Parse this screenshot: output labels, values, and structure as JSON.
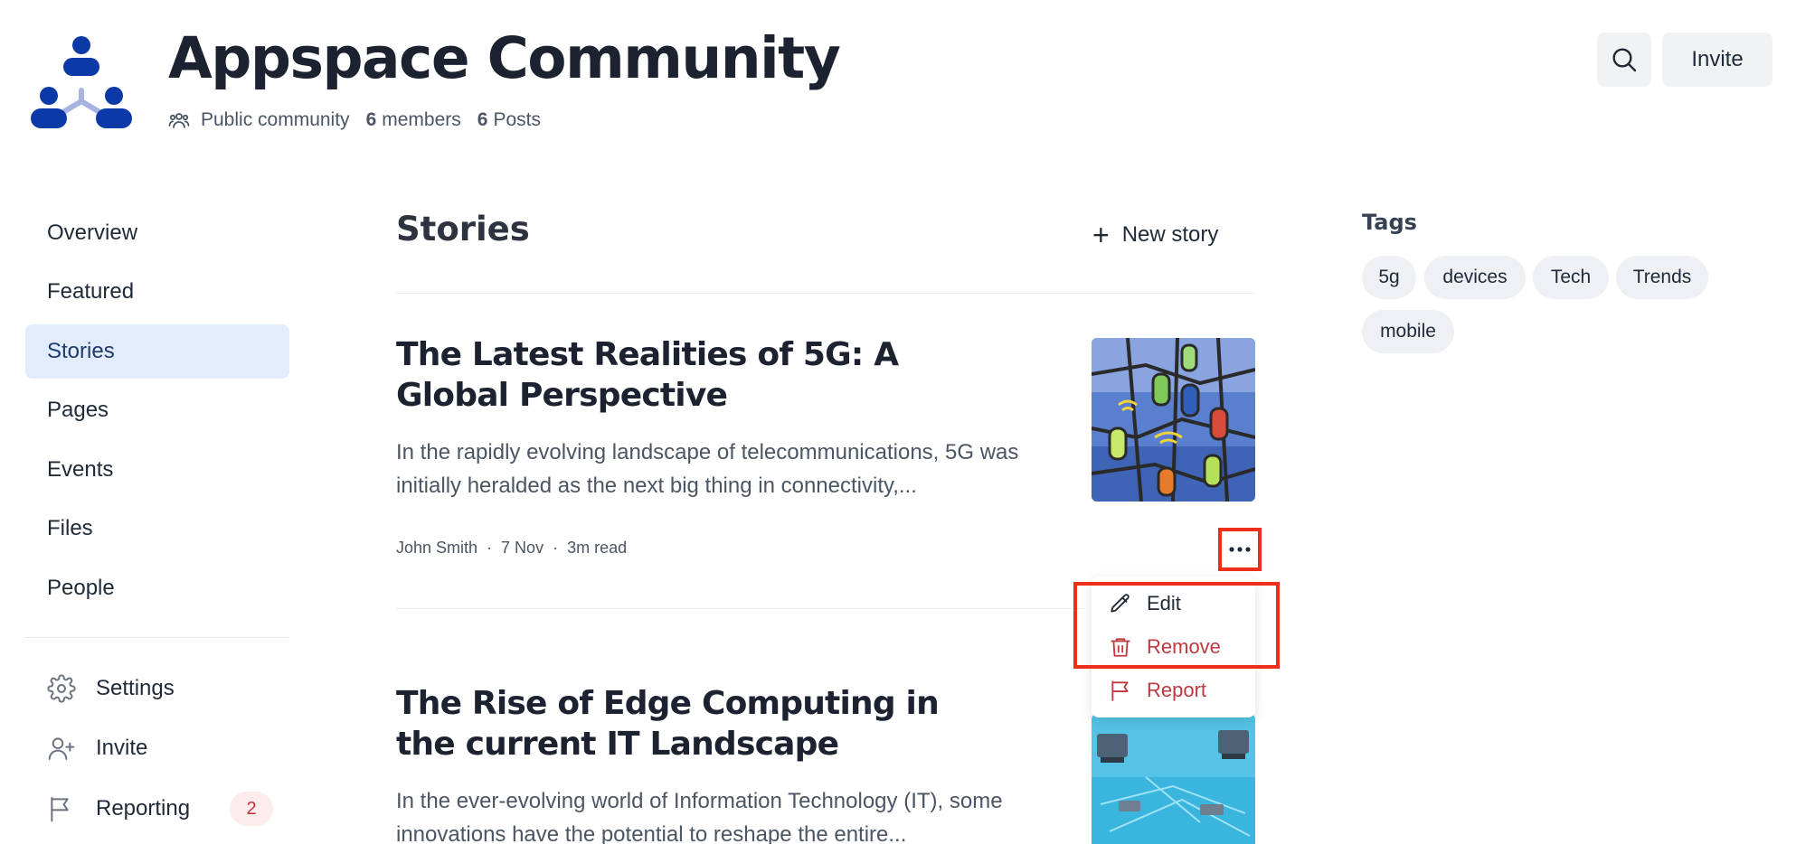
{
  "header": {
    "title": "Appspace Community",
    "visibility": "Public community",
    "members_count": "6",
    "members_label": "members",
    "posts_count": "6",
    "posts_label": "Posts",
    "invite_label": "Invite"
  },
  "sidebar": {
    "items": [
      {
        "label": "Overview"
      },
      {
        "label": "Featured"
      },
      {
        "label": "Stories",
        "active": true
      },
      {
        "label": "Pages"
      },
      {
        "label": "Events"
      },
      {
        "label": "Files"
      },
      {
        "label": "People"
      }
    ],
    "actions": [
      {
        "label": "Settings",
        "icon": "gear-icon"
      },
      {
        "label": "Invite",
        "icon": "user-plus-icon"
      },
      {
        "label": "Reporting",
        "icon": "flag-icon",
        "badge": "2"
      }
    ]
  },
  "main": {
    "section_title": "Stories",
    "new_story_label": "New story",
    "stories": [
      {
        "title": "The Latest Realities of 5G: A Global Perspective",
        "excerpt": "In the rapidly evolving landscape of telecommunications, 5G was initially heralded as the next big thing in connectivity,...",
        "author": "John Smith",
        "date": "7 Nov",
        "read_time": "3m read"
      },
      {
        "title": "The Rise of Edge Computing in the current IT Landscape",
        "excerpt": "In the ever-evolving world of Information Technology (IT), some innovations have the potential to reshape the entire..."
      }
    ],
    "context_menu": {
      "edit": "Edit",
      "remove": "Remove",
      "report": "Report"
    }
  },
  "tags": {
    "title": "Tags",
    "items": [
      "5g",
      "devices",
      "Tech",
      "Trends",
      "mobile"
    ]
  },
  "colors": {
    "brand": "#1a3fa6",
    "active_bg": "#e2ecfd",
    "danger": "#c0393f",
    "highlight": "#ee2e1b"
  }
}
